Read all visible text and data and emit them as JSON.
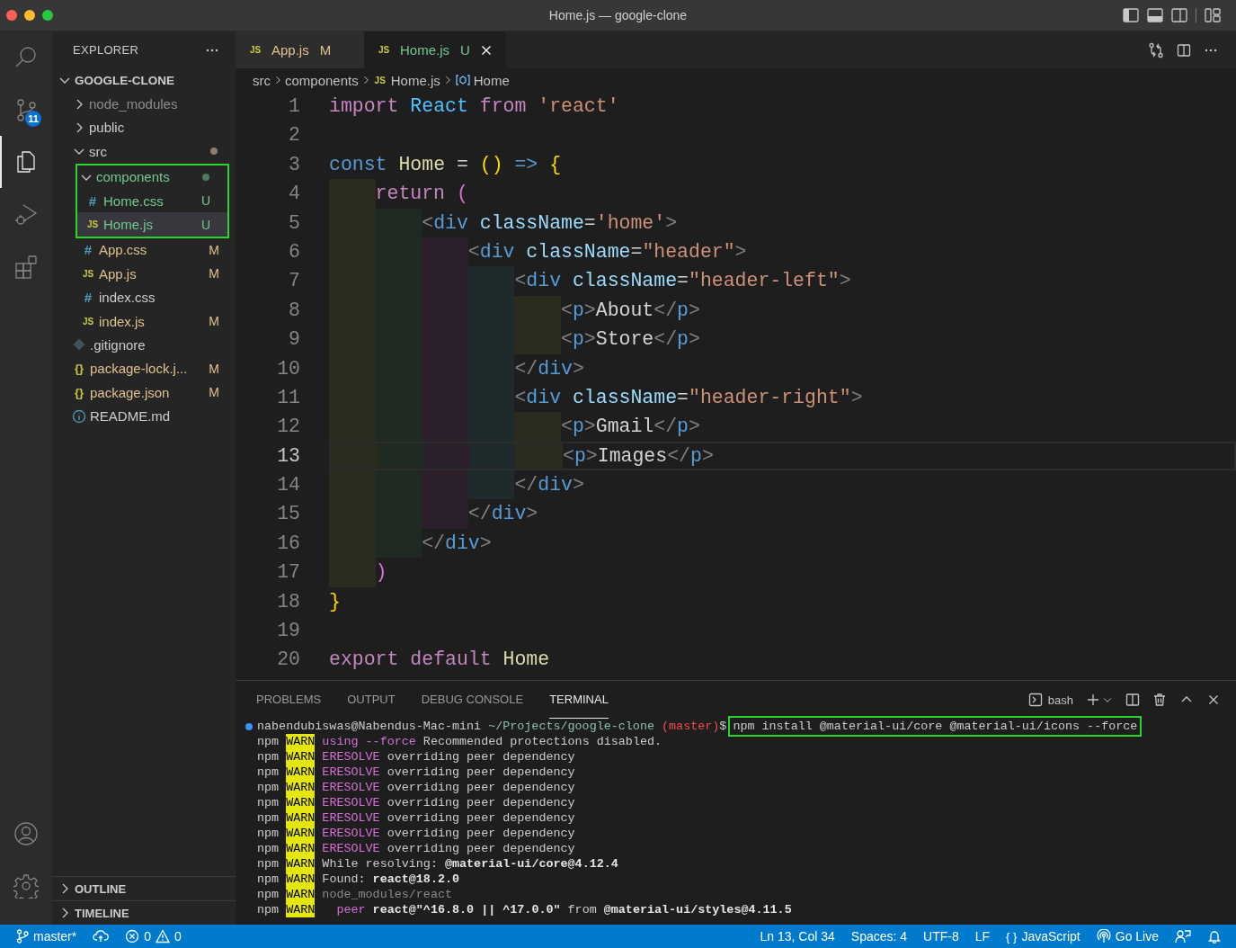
{
  "window": {
    "title": "Home.js — google-clone"
  },
  "activity_bar": {
    "items": [
      {
        "kind": "search",
        "selected": false
      },
      {
        "kind": "source-control",
        "selected": false,
        "badge": "11"
      },
      {
        "kind": "explorer",
        "selected": true
      },
      {
        "kind": "run-debug",
        "selected": false
      },
      {
        "kind": "extensions",
        "selected": false
      }
    ],
    "bottom": [
      {
        "kind": "account"
      },
      {
        "kind": "settings"
      }
    ]
  },
  "sidebar": {
    "title": "EXPLORER",
    "root": {
      "label": "GOOGLE-CLONE",
      "expanded": true,
      "children": [
        {
          "kind": "folder",
          "label": "node_modules",
          "expanded": false,
          "ignored": true,
          "selected": false,
          "highlighted": false
        },
        {
          "kind": "folder",
          "label": "public",
          "expanded": false,
          "ignored": false,
          "selected": false,
          "highlighted": false
        },
        {
          "kind": "folder",
          "label": "src",
          "expanded": true,
          "ignored": false,
          "color": "#8d7f6a",
          "selected": false,
          "highlighted": false,
          "children": [
            {
              "kind": "folder",
              "label": "components",
              "expanded": true,
              "ignored": false,
              "untracked": true,
              "color": "#4c7a5c",
              "selected": false,
              "highlighted": true,
              "children": [
                {
                  "kind": "css",
                  "glyph": "#",
                  "label": "Home.css",
                  "status": "U",
                  "selected": false,
                  "highlighted": false
                },
                {
                  "kind": "js",
                  "glyph": "JS",
                  "label": "Home.js",
                  "status": "U",
                  "selected": true,
                  "highlighted": false
                }
              ]
            },
            {
              "kind": "css",
              "glyph": "#",
              "label": "App.css",
              "status": "M",
              "selected": false,
              "highlighted": false
            },
            {
              "kind": "js",
              "glyph": "JS",
              "label": "App.js",
              "status": "M",
              "selected": false,
              "highlighted": false
            },
            {
              "kind": "css",
              "glyph": "#",
              "label": "index.css",
              "selected": false,
              "highlighted": false
            },
            {
              "kind": "js",
              "glyph": "JS",
              "label": "index.js",
              "status": "M",
              "selected": false,
              "highlighted": false
            }
          ]
        },
        {
          "kind": "gitignore",
          "label": ".gitignore",
          "selected": false,
          "highlighted": false
        },
        {
          "kind": "json",
          "glyph": "{}",
          "label": "package-lock.j...",
          "status": "M",
          "selected": false,
          "highlighted": false
        },
        {
          "kind": "json",
          "glyph": "{}",
          "label": "package.json",
          "status": "M",
          "selected": false,
          "highlighted": false
        },
        {
          "kind": "info",
          "label": "README.md",
          "selected": false,
          "highlighted": false
        }
      ]
    },
    "sections": [
      {
        "label": "OUTLINE",
        "expanded": false
      },
      {
        "label": "TIMELINE",
        "expanded": false
      }
    ]
  },
  "tabs": [
    {
      "glyph": "JS",
      "label": "App.js",
      "status": "M",
      "selected": false
    },
    {
      "glyph": "JS",
      "label": "Home.js",
      "status": "U",
      "selected": true
    }
  ],
  "breadcrumb": [
    {
      "kind": "folder",
      "label": "src"
    },
    {
      "kind": "folder",
      "label": "components"
    },
    {
      "kind": "file",
      "glyph": "JS",
      "label": "Home.js"
    },
    {
      "kind": "symbol",
      "label": "Home"
    }
  ],
  "editor": {
    "lines": [
      {
        "number": "1",
        "current": false,
        "tokens": [
          {
            "text": "import ",
            "kind": "kw"
          },
          {
            "text": "React ",
            "kind": "var"
          },
          {
            "text": "from ",
            "kind": "kw"
          },
          {
            "text": "'react'",
            "kind": "str"
          }
        ]
      },
      {
        "number": "2",
        "current": false
      },
      {
        "number": "3",
        "current": false,
        "tokens": [
          {
            "text": "const ",
            "kind": "storage"
          },
          {
            "text": "Home",
            "kind": "fn"
          },
          {
            "text": " = ",
            "kind": "op"
          },
          {
            "text": "()",
            "kind": "brace1"
          },
          {
            "text": " => ",
            "kind": "storage"
          },
          {
            "text": "{",
            "kind": "brace1"
          }
        ]
      },
      {
        "number": "4",
        "current": false,
        "tokens": [
          {
            "text": "    return ",
            "kind": "kw"
          },
          {
            "text": "(",
            "kind": "brace2"
          }
        ]
      },
      {
        "number": "5",
        "current": false,
        "tokens": [
          {
            "text": "        <",
            "kind": "punct"
          },
          {
            "text": "div ",
            "kind": "tag"
          },
          {
            "text": "className",
            "kind": "attr"
          },
          {
            "text": "=",
            "kind": "op"
          },
          {
            "text": "'home'",
            "kind": "str"
          },
          {
            "text": ">",
            "kind": "punct"
          }
        ]
      },
      {
        "number": "6",
        "current": false,
        "tokens": [
          {
            "text": "            <",
            "kind": "punct"
          },
          {
            "text": "div ",
            "kind": "tag"
          },
          {
            "text": "className",
            "kind": "attr"
          },
          {
            "text": "=",
            "kind": "op"
          },
          {
            "text": "\"header\"",
            "kind": "str"
          },
          {
            "text": ">",
            "kind": "punct"
          }
        ]
      },
      {
        "number": "7",
        "current": false,
        "tokens": [
          {
            "text": "                <",
            "kind": "punct"
          },
          {
            "text": "div ",
            "kind": "tag"
          },
          {
            "text": "className",
            "kind": "attr"
          },
          {
            "text": "=",
            "kind": "op"
          },
          {
            "text": "\"header-left\"",
            "kind": "str"
          },
          {
            "text": ">",
            "kind": "punct"
          }
        ]
      },
      {
        "number": "8",
        "current": false,
        "tokens": [
          {
            "text": "                    <",
            "kind": "punct"
          },
          {
            "text": "p",
            "kind": "tag"
          },
          {
            "text": ">",
            "kind": "punct"
          },
          {
            "text": "About",
            "kind": "text"
          },
          {
            "text": "</",
            "kind": "punct"
          },
          {
            "text": "p",
            "kind": "tag"
          },
          {
            "text": ">",
            "kind": "punct"
          }
        ]
      },
      {
        "number": "9",
        "current": false,
        "tokens": [
          {
            "text": "                    <",
            "kind": "punct"
          },
          {
            "text": "p",
            "kind": "tag"
          },
          {
            "text": ">",
            "kind": "punct"
          },
          {
            "text": "Store",
            "kind": "text"
          },
          {
            "text": "</",
            "kind": "punct"
          },
          {
            "text": "p",
            "kind": "tag"
          },
          {
            "text": ">",
            "kind": "punct"
          }
        ]
      },
      {
        "number": "10",
        "current": false,
        "tokens": [
          {
            "text": "                </",
            "kind": "punct"
          },
          {
            "text": "div",
            "kind": "tag"
          },
          {
            "text": ">",
            "kind": "punct"
          }
        ]
      },
      {
        "number": "11",
        "current": false,
        "tokens": [
          {
            "text": "                <",
            "kind": "punct"
          },
          {
            "text": "div ",
            "kind": "tag"
          },
          {
            "text": "className",
            "kind": "attr"
          },
          {
            "text": "=",
            "kind": "op"
          },
          {
            "text": "\"header-right\"",
            "kind": "str"
          },
          {
            "text": ">",
            "kind": "punct"
          }
        ]
      },
      {
        "number": "12",
        "current": false,
        "tokens": [
          {
            "text": "                    <",
            "kind": "punct"
          },
          {
            "text": "p",
            "kind": "tag"
          },
          {
            "text": ">",
            "kind": "punct"
          },
          {
            "text": "Gmail",
            "kind": "text"
          },
          {
            "text": "</",
            "kind": "punct"
          },
          {
            "text": "p",
            "kind": "tag"
          },
          {
            "text": ">",
            "kind": "punct"
          }
        ]
      },
      {
        "number": "13",
        "current": true,
        "tokens": [
          {
            "text": "                    <",
            "kind": "punct"
          },
          {
            "text": "p",
            "kind": "tag"
          },
          {
            "text": ">",
            "kind": "punct"
          },
          {
            "text": "Images",
            "kind": "text"
          },
          {
            "text": "</",
            "kind": "punct"
          },
          {
            "text": "p",
            "kind": "tag"
          },
          {
            "text": ">",
            "kind": "punct"
          }
        ]
      },
      {
        "number": "14",
        "current": false,
        "tokens": [
          {
            "text": "                </",
            "kind": "punct"
          },
          {
            "text": "div",
            "kind": "tag"
          },
          {
            "text": ">",
            "kind": "punct"
          }
        ]
      },
      {
        "number": "15",
        "current": false,
        "tokens": [
          {
            "text": "            </",
            "kind": "punct"
          },
          {
            "text": "div",
            "kind": "tag"
          },
          {
            "text": ">",
            "kind": "punct"
          }
        ]
      },
      {
        "number": "16",
        "current": false,
        "tokens": [
          {
            "text": "        </",
            "kind": "punct"
          },
          {
            "text": "div",
            "kind": "tag"
          },
          {
            "text": ">",
            "kind": "punct"
          }
        ]
      },
      {
        "number": "17",
        "current": false,
        "tokens": [
          {
            "text": "    )",
            "kind": "brace2"
          }
        ]
      },
      {
        "number": "18",
        "current": false,
        "tokens": [
          {
            "text": "}",
            "kind": "brace1"
          }
        ]
      },
      {
        "number": "19",
        "current": false
      },
      {
        "number": "20",
        "current": false,
        "tokens": [
          {
            "text": "export ",
            "kind": "kw"
          },
          {
            "text": "default ",
            "kind": "kw"
          },
          {
            "text": "Home",
            "kind": "fn"
          }
        ]
      }
    ]
  },
  "panel": {
    "tabs": [
      {
        "label": "PROBLEMS",
        "selected": false
      },
      {
        "label": "OUTPUT",
        "selected": false
      },
      {
        "label": "DEBUG CONSOLE",
        "selected": false
      },
      {
        "label": "TERMINAL",
        "selected": true
      }
    ],
    "shell": "bash",
    "terminal": {
      "prompt": {
        "user": "nabendubiswas@Nabendus-Mac-mini",
        "path": "~/Projects/google-clone",
        "branch": "(master)",
        "symbol": "$",
        "command": "npm install @material-ui/core @material-ui/icons --force",
        "highlighted": true
      },
      "lines": [
        [
          {
            "text": "npm ",
            "kind": "plain"
          },
          {
            "text": "WARN",
            "kind": "warn"
          },
          {
            "text": " using --force",
            "kind": "magenta"
          },
          {
            "text": " Recommended protections disabled.",
            "kind": "plain"
          }
        ],
        [
          {
            "text": "npm ",
            "kind": "plain"
          },
          {
            "text": "WARN",
            "kind": "warn"
          },
          {
            "text": " ERESOLVE",
            "kind": "magenta"
          },
          {
            "text": " overriding peer dependency",
            "kind": "plain"
          }
        ],
        [
          {
            "text": "npm ",
            "kind": "plain"
          },
          {
            "text": "WARN",
            "kind": "warn"
          },
          {
            "text": " ERESOLVE",
            "kind": "magenta"
          },
          {
            "text": " overriding peer dependency",
            "kind": "plain"
          }
        ],
        [
          {
            "text": "npm ",
            "kind": "plain"
          },
          {
            "text": "WARN",
            "kind": "warn"
          },
          {
            "text": " ERESOLVE",
            "kind": "magenta"
          },
          {
            "text": " overriding peer dependency",
            "kind": "plain"
          }
        ],
        [
          {
            "text": "npm ",
            "kind": "plain"
          },
          {
            "text": "WARN",
            "kind": "warn"
          },
          {
            "text": " ERESOLVE",
            "kind": "magenta"
          },
          {
            "text": " overriding peer dependency",
            "kind": "plain"
          }
        ],
        [
          {
            "text": "npm ",
            "kind": "plain"
          },
          {
            "text": "WARN",
            "kind": "warn"
          },
          {
            "text": " ERESOLVE",
            "kind": "magenta"
          },
          {
            "text": " overriding peer dependency",
            "kind": "plain"
          }
        ],
        [
          {
            "text": "npm ",
            "kind": "plain"
          },
          {
            "text": "WARN",
            "kind": "warn"
          },
          {
            "text": " ERESOLVE",
            "kind": "magenta"
          },
          {
            "text": " overriding peer dependency",
            "kind": "plain"
          }
        ],
        [
          {
            "text": "npm ",
            "kind": "plain"
          },
          {
            "text": "WARN",
            "kind": "warn"
          },
          {
            "text": " ERESOLVE",
            "kind": "magenta"
          },
          {
            "text": " overriding peer dependency",
            "kind": "plain"
          }
        ],
        [
          {
            "text": "npm ",
            "kind": "plain"
          },
          {
            "text": "WARN",
            "kind": "warn"
          },
          {
            "text": " While resolving: ",
            "kind": "plain"
          },
          {
            "text": "@material-ui/core@4.12.4",
            "kind": "bold"
          }
        ],
        [
          {
            "text": "npm ",
            "kind": "plain"
          },
          {
            "text": "WARN",
            "kind": "warn"
          },
          {
            "text": " Found: ",
            "kind": "plain"
          },
          {
            "text": "react@18.2.0",
            "kind": "bold"
          }
        ],
        [
          {
            "text": "npm ",
            "kind": "plain"
          },
          {
            "text": "WARN",
            "kind": "warn"
          },
          {
            "text": " node_modules/react",
            "kind": "dim"
          }
        ],
        [
          {
            "text": "npm ",
            "kind": "plain"
          },
          {
            "text": "WARN",
            "kind": "warn"
          },
          {
            "text": "   peer",
            "kind": "magenta"
          },
          {
            "text": " react@\"^16.8.0 || ^17.0.0\"",
            "kind": "bold"
          },
          {
            "text": " from ",
            "kind": "plain"
          },
          {
            "text": "@material-ui/styles@4.11.5",
            "kind": "bold"
          }
        ]
      ]
    }
  },
  "status_bar": {
    "branch": "master*",
    "errors": "0",
    "warnings": "0",
    "items": [
      {
        "kind": "text",
        "label": "Ln 13, Col 34"
      },
      {
        "kind": "text",
        "label": "Spaces: 4"
      },
      {
        "kind": "text",
        "label": "UTF-8"
      },
      {
        "kind": "text",
        "label": "LF"
      },
      {
        "kind": "language",
        "glyph": "{ }",
        "label": "JavaScript"
      },
      {
        "kind": "live",
        "label": "Go Live"
      }
    ]
  }
}
